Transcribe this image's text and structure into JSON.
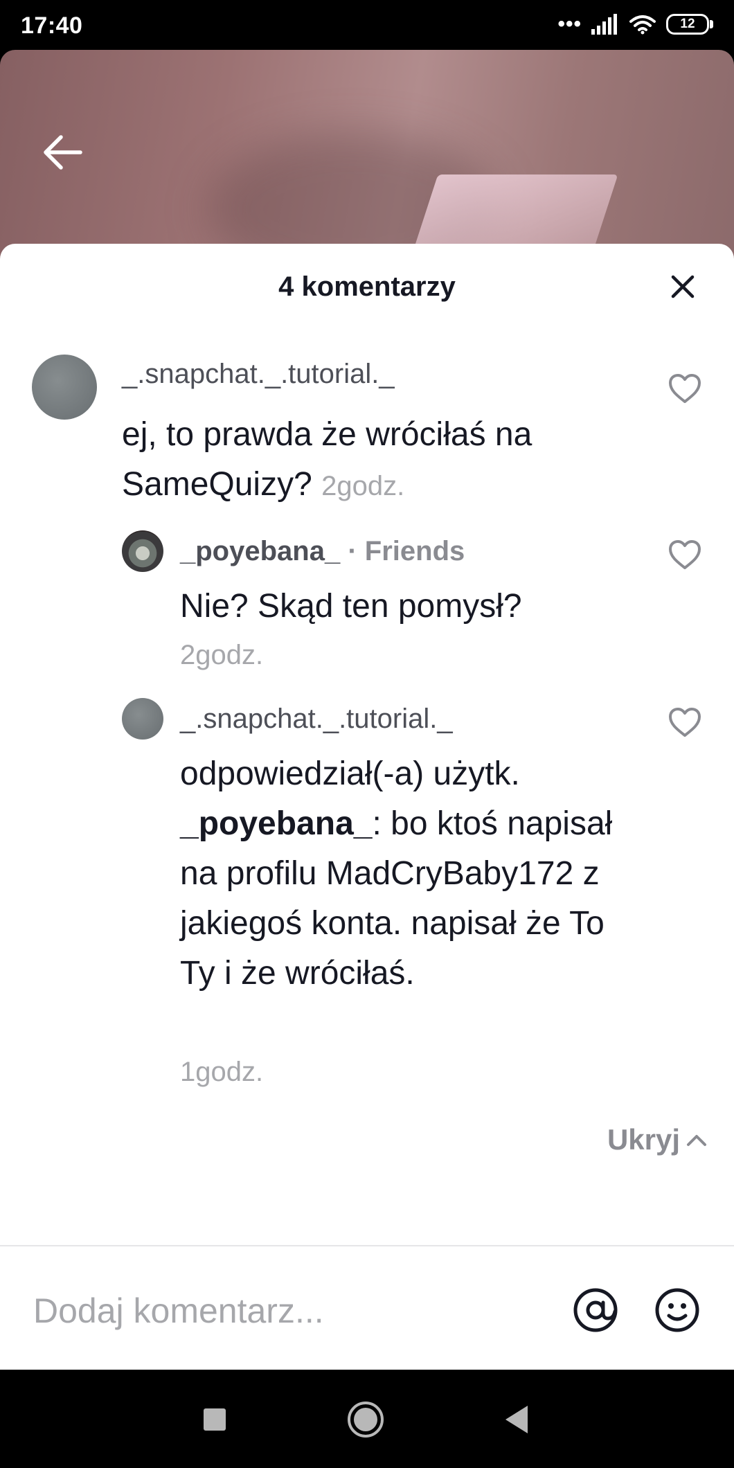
{
  "status_bar": {
    "time": "17:40",
    "signal_dots": "•••",
    "battery": "12"
  },
  "sheet": {
    "title": "4 komentarzy"
  },
  "comments": [
    {
      "username": "_.snapchat._.tutorial._",
      "text": "ej, to prawda że wróciłaś na SameQuizy?",
      "time": "2godz."
    },
    {
      "username": "_poyebana_",
      "tag": "· Friends",
      "text": "Nie? Skąd ten pomysł?",
      "time": "2godz."
    },
    {
      "username": "_.snapchat._.tutorial._",
      "text_prefix": "odpowiedział(-a) użytk.",
      "mention": "_poyebana_",
      "text_suffix": ": bo ktoś napisał na profilu MadCryBaby172 z jakiegoś konta. napisał że To Ty i że wróciłaś.",
      "time": "1godz."
    }
  ],
  "hide_label": "Ukryj",
  "input": {
    "placeholder": "Dodaj komentarz..."
  },
  "colors": {
    "text": "#161823",
    "secondary": "#a6a7ab",
    "background": "#ffffff"
  },
  "icons": [
    "back-arrow-icon",
    "close-icon",
    "heart-icon",
    "chevron-up-icon",
    "at-icon",
    "emoji-icon",
    "nav-square-icon",
    "nav-home-icon",
    "nav-back-icon"
  ]
}
